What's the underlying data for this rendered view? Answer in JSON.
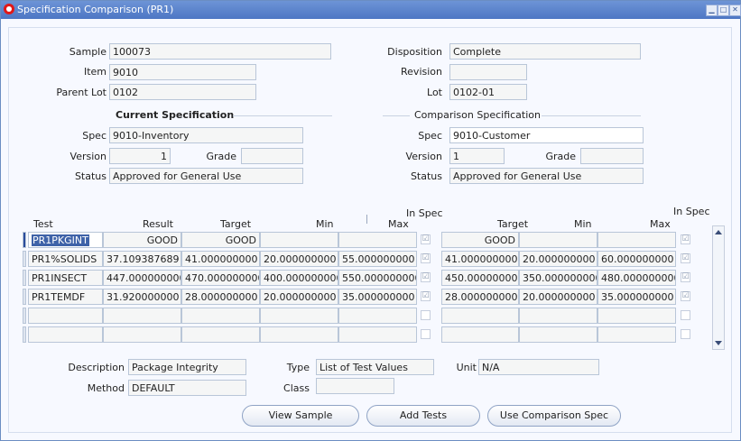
{
  "window": {
    "title": "Specification Comparison (PR1)"
  },
  "header": {
    "sample_label": "Sample",
    "sample": "100073",
    "item_label": "Item",
    "item": "9010",
    "parent_lot_label": "Parent Lot",
    "parent_lot": "0102",
    "disposition_label": "Disposition",
    "disposition": "Complete",
    "revision_label": "Revision",
    "revision": "",
    "lot_label": "Lot",
    "lot": "0102-01"
  },
  "current_spec": {
    "heading": "Current Specification",
    "spec_label": "Spec",
    "spec": "9010-Inventory",
    "version_label": "Version",
    "version": "1",
    "grade_label": "Grade",
    "grade": "",
    "status_label": "Status",
    "status": "Approved for General Use"
  },
  "comparison_spec": {
    "heading": "Comparison Specification",
    "spec_label": "Spec",
    "spec": "9010-Customer",
    "version_label": "Version",
    "version": "1",
    "grade_label": "Grade",
    "grade": "",
    "status_label": "Status",
    "status": "Approved for General Use"
  },
  "table": {
    "headers": {
      "test": "Test",
      "result": "Result",
      "target": "Target",
      "min": "Min",
      "max": "Max",
      "in_spec": "In Spec",
      "cmp_target": "Target",
      "cmp_min": "Min",
      "cmp_max": "Max",
      "cmp_in_spec": "In Spec"
    },
    "rows": [
      {
        "test": "PR1PKGINT",
        "result": "GOOD",
        "target": "GOOD",
        "min": "",
        "max": "",
        "in_spec": "☑",
        "cmp_target": "GOOD",
        "cmp_min": "",
        "cmp_max": "",
        "cmp_in_spec": "☑"
      },
      {
        "test": "PR1%SOLIDS",
        "result": "37.109387689",
        "target": "41.000000000",
        "min": "20.000000000",
        "max": "55.000000000",
        "in_spec": "☑",
        "cmp_target": "41.000000000",
        "cmp_min": "20.000000000",
        "cmp_max": "60.000000000",
        "cmp_in_spec": "☑"
      },
      {
        "test": "PR1INSECT",
        "result": "447.000000000",
        "target": "470.000000000",
        "min": "400.000000000",
        "max": "550.000000000",
        "in_spec": "☑",
        "cmp_target": "450.000000000",
        "cmp_min": "350.000000000",
        "cmp_max": "480.000000000",
        "cmp_in_spec": "☑"
      },
      {
        "test": "PR1TEMDF",
        "result": "31.920000000",
        "target": "28.000000000",
        "min": "20.000000000",
        "max": "35.000000000",
        "in_spec": "☑",
        "cmp_target": "28.000000000",
        "cmp_min": "20.000000000",
        "cmp_max": "35.000000000",
        "cmp_in_spec": "☑"
      },
      {
        "test": "",
        "result": "",
        "target": "",
        "min": "",
        "max": "",
        "in_spec": "",
        "cmp_target": "",
        "cmp_min": "",
        "cmp_max": "",
        "cmp_in_spec": ""
      },
      {
        "test": "",
        "result": "",
        "target": "",
        "min": "",
        "max": "",
        "in_spec": "",
        "cmp_target": "",
        "cmp_min": "",
        "cmp_max": "",
        "cmp_in_spec": ""
      }
    ]
  },
  "details": {
    "description_label": "Description",
    "description": "Package Integrity",
    "method_label": "Method",
    "method": "DEFAULT",
    "type_label": "Type",
    "type": "List of Test Values",
    "class_label": "Class",
    "class": "",
    "unit_label": "Unit",
    "unit": "N/A"
  },
  "buttons": {
    "view_sample": "View Sample",
    "add_tests": "Add Tests",
    "use_comparison_spec": "Use Comparison Spec"
  }
}
